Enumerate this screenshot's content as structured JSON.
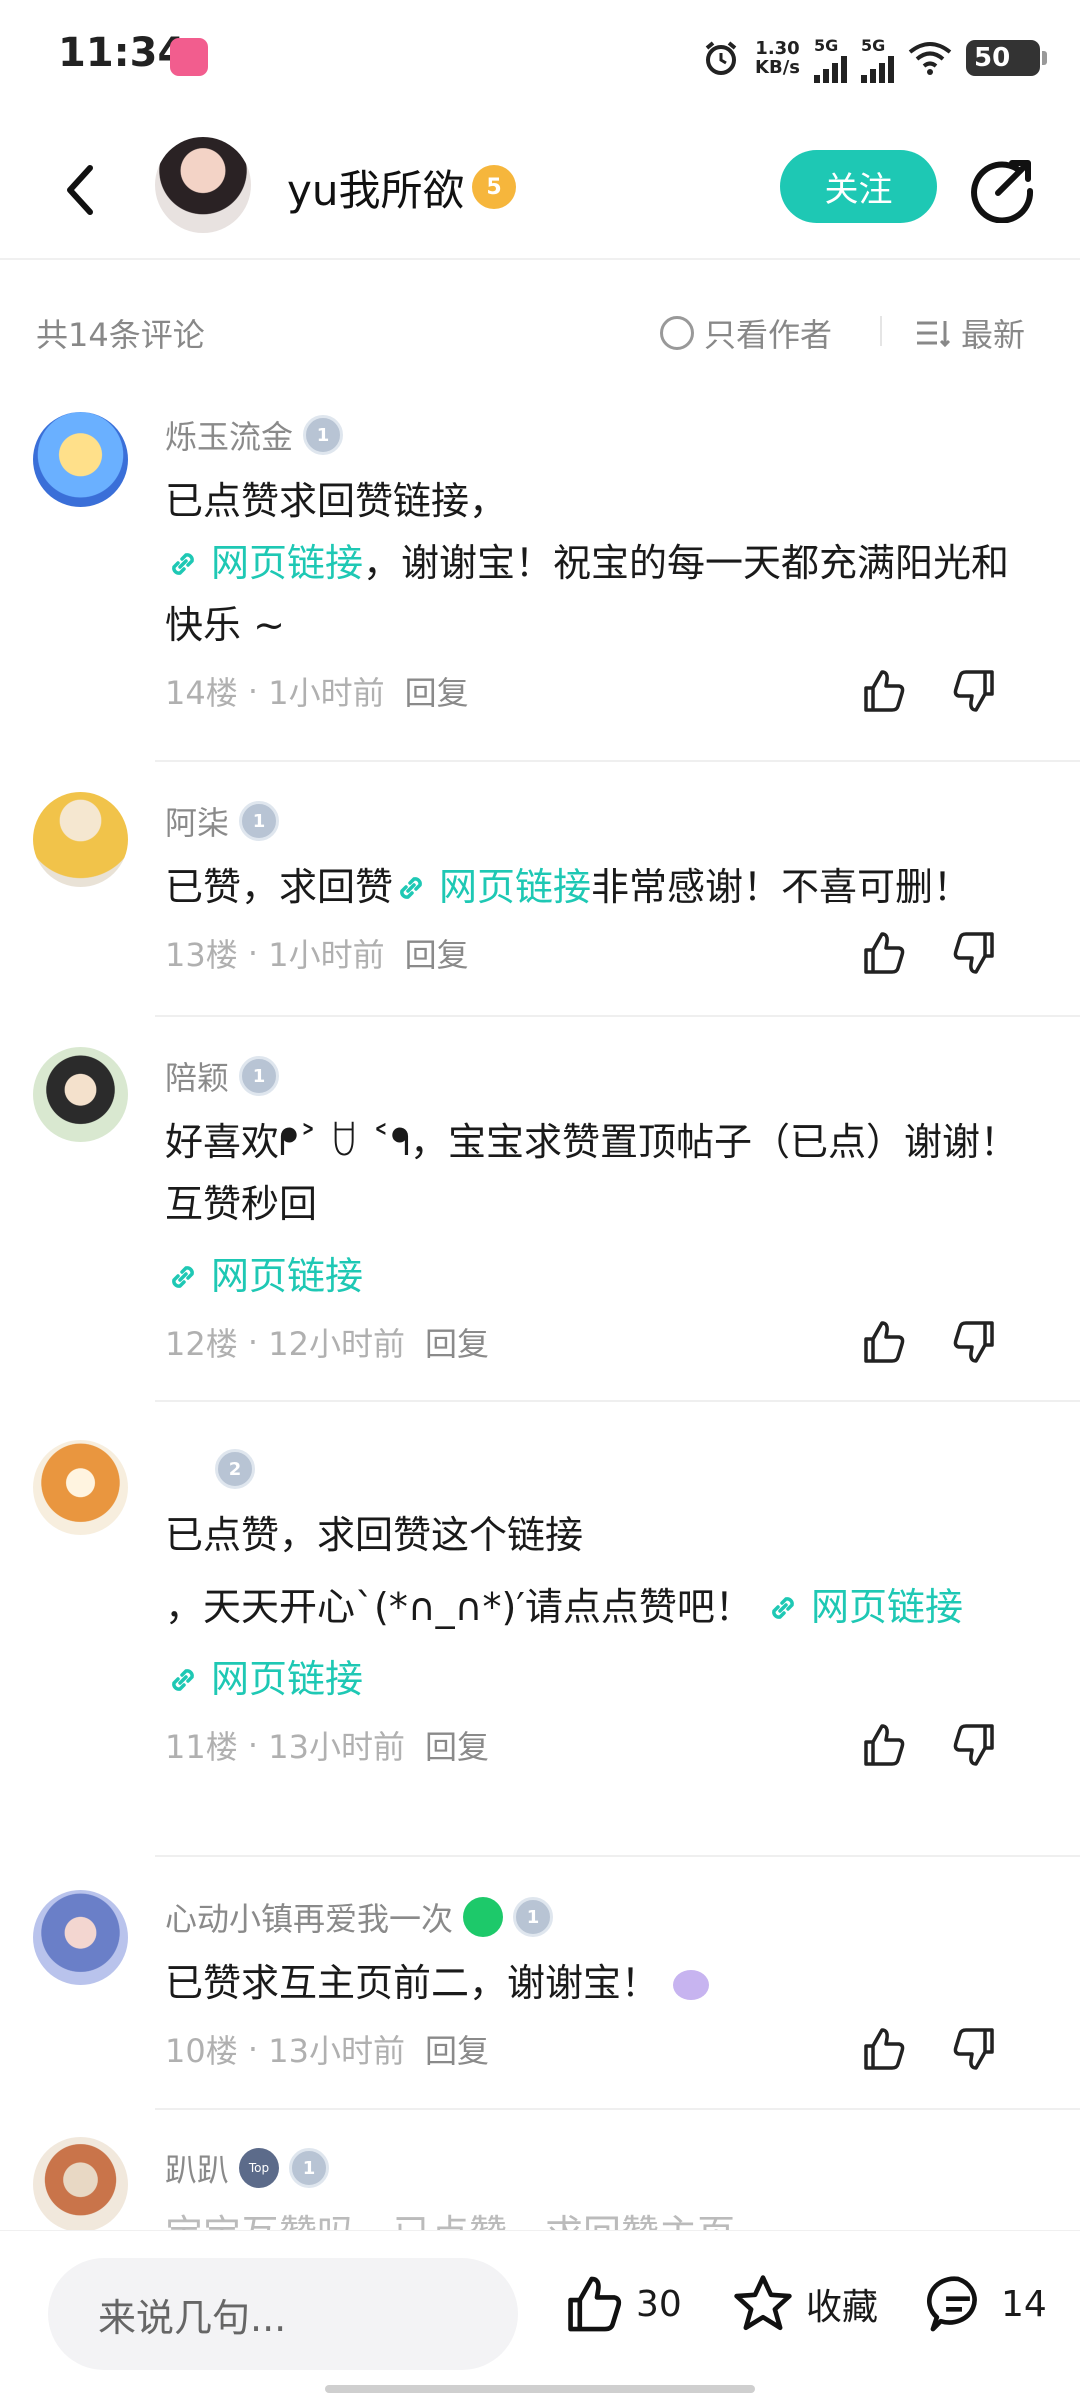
{
  "status": {
    "time": "11:34",
    "net_speed_value": "1.30",
    "net_speed_unit": "KB/s",
    "signal1": "5G",
    "signal2": "5G",
    "battery": "50"
  },
  "header": {
    "author_name": "yu我所欲",
    "author_level": "5",
    "follow_label": "关注"
  },
  "sort": {
    "count_label": "共14条评论",
    "author_only_label": "只看作者",
    "latest_label": "最新"
  },
  "comments": [
    {
      "user": "烁玉流金",
      "level": "1",
      "lines": [
        "已点赞求回赞链接，"
      ],
      "link_text": "网页链接",
      "after_link": "，谢谢宝！祝宝的每一天都充满阳光和快乐 ~",
      "floor": "14楼",
      "time": "1小时前",
      "reply": "回复"
    },
    {
      "user": "阿柒",
      "level": "1",
      "text_before": "已赞，求回赞",
      "link_text": "网页链接",
      "text_after": "非常感谢！不喜可删！",
      "floor": "13楼",
      "time": "1小时前",
      "reply": "回复"
    },
    {
      "user": "陪颖",
      "level": "1",
      "text": "好喜欢ᖰ˃ ꇴ ˂ᖳ，宝宝求赞置顶帖子（已点）谢谢！ 互赞秒回",
      "link_text": "网页链接",
      "floor": "12楼",
      "time": "12小时前",
      "reply": "回复"
    },
    {
      "user": "",
      "level": "2",
      "line1": "已点赞，求回赞这个链接",
      "line2": "，天天开心`(*∩_∩*)′请点点赞吧！",
      "link_text_inline": "网页链接",
      "link_text": "网页链接",
      "floor": "11楼",
      "time": "13小时前",
      "reply": "回复"
    },
    {
      "user": "心动小镇再爱我一次",
      "level": "1",
      "text": "已赞求互主页前二，谢谢宝！",
      "floor": "10楼",
      "time": "13小时前",
      "reply": "回复"
    },
    {
      "user": "趴趴",
      "level": "1",
      "fan_badge": "Top",
      "text": "宝宝互赞吗，已点赞，求回赞主页"
    }
  ],
  "bottom": {
    "input_placeholder": "来说几句...",
    "like_count": "30",
    "favorite_label": "收藏",
    "comment_count": "14"
  },
  "colors": {
    "accent": "#1ec8b4",
    "text_primary": "#1a1a1a",
    "text_secondary": "#8a8a8a"
  }
}
